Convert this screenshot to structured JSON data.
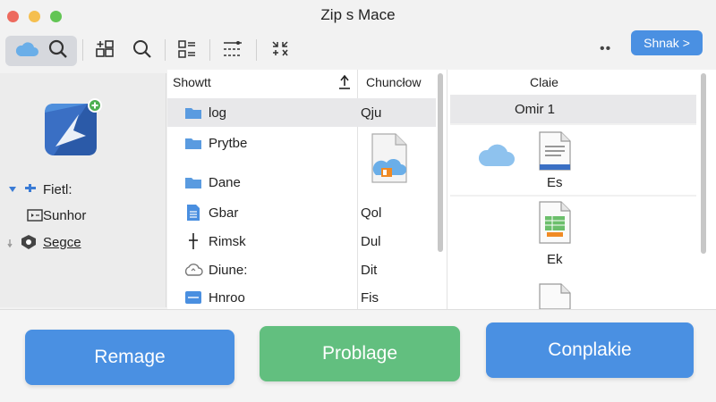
{
  "window": {
    "title": "Zip s Mace"
  },
  "toolbar": {
    "buttons": [
      {
        "name": "cloud-view",
        "icon": "cloud-icon"
      },
      {
        "name": "search",
        "icon": "search-icon"
      },
      {
        "name": "add-grid",
        "icon": "grid-plus-icon"
      },
      {
        "name": "search-2",
        "icon": "search-icon"
      },
      {
        "name": "columns",
        "icon": "columns-icon"
      },
      {
        "name": "list-options",
        "icon": "list-icon"
      },
      {
        "name": "collapse",
        "icon": "collapse-icon"
      }
    ],
    "more_label": "••",
    "share_label": "Shnak >"
  },
  "sidebar": {
    "items": [
      {
        "label": "Fietl:",
        "icon": "toggle-icon"
      },
      {
        "label": "Sunhor",
        "icon": "display-icon"
      },
      {
        "label": "Segce",
        "icon": "shield-icon"
      }
    ]
  },
  "columns": {
    "col1_header": "Showtt",
    "col2_header": "Chuncłow",
    "col3_header": "Claie"
  },
  "files": [
    {
      "name": "log",
      "icon": "folder-icon",
      "value": "Qju"
    },
    {
      "name": "Prytbe",
      "icon": "folder-icon",
      "value": ""
    },
    {
      "name": "Dane",
      "icon": "folder-icon",
      "value": ""
    },
    {
      "name": "Gbar",
      "icon": "document-icon",
      "value": "Qol"
    },
    {
      "name": "Rimsk",
      "icon": "pin-icon",
      "value": "Dul"
    },
    {
      "name": "Diune:",
      "icon": "cloud-sync-icon",
      "value": "Dit"
    },
    {
      "name": "Hnroo",
      "icon": "document-icon",
      "value": "Fis"
    }
  ],
  "preview": {
    "selected_item": "Omir 1",
    "items": [
      {
        "label": "Es",
        "icon": "text-file-icon"
      },
      {
        "label": "Ek",
        "icon": "spreadsheet-file-icon"
      }
    ]
  },
  "footer": {
    "left_button": "Remage",
    "center_button": "Problage",
    "right_button": "Conplakie"
  },
  "colors": {
    "accent_blue": "#4a90e2",
    "accent_green": "#62bf7f",
    "folder_blue": "#5a9be0"
  }
}
